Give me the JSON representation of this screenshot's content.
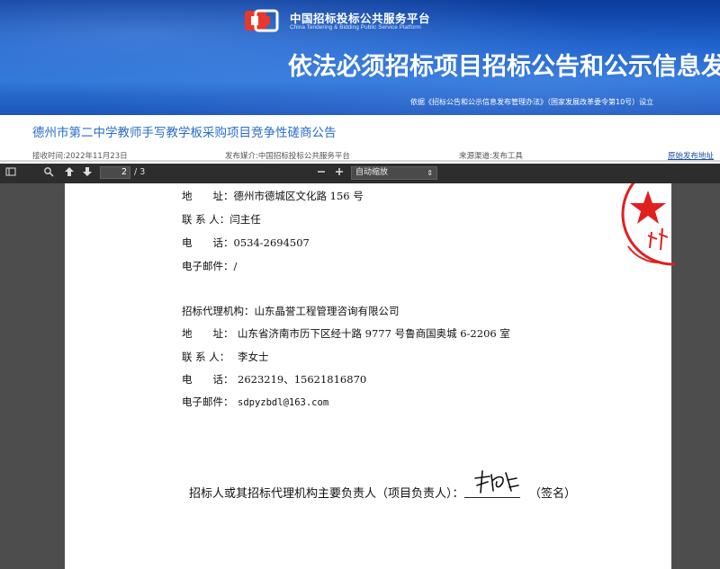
{
  "banner": {
    "logo_cn": "中国招标投标公共服务平台",
    "logo_en": "China Tendering & Bidding Public Service Platform",
    "title": "依法必须招标项目招标公告和公示信息发布",
    "basis": "依据《招标公告和公示信息发布管理办法》（国家发展改革委令第10号）设立"
  },
  "notice": {
    "title": "德州市第二中学教师手写教学板采购项目竞争性磋商公告",
    "received_time": "接收时间:2022年11月23日",
    "publisher": "发布媒介:中国招标投标公共服务平台",
    "source": "来源渠道:发布工具",
    "original_link": "原始发布地址"
  },
  "toolbar": {
    "current_page": "2",
    "total_pages": "/ 3",
    "zoom_label": "自动缩放",
    "icons": [
      "sidebar-toggle-icon",
      "search-icon",
      "arrow-up-icon",
      "arrow-down-icon",
      "zoom-out-icon",
      "zoom-in-icon"
    ]
  },
  "document": {
    "rows": [
      {
        "label": "地　　址：",
        "value": "德州市德城区文化路 156 号"
      },
      {
        "label": "联 系 人：",
        "value": "闫主任"
      },
      {
        "label": "电　　话：",
        "value": "0534-2694507"
      },
      {
        "label": "电子邮件：",
        "value": "/"
      },
      {
        "label": "招标代理机构：",
        "value": "山东晶誉工程管理咨询有限公司"
      },
      {
        "label": "地　　址：",
        "value": "山东省济南市历下区经十路 9777 号鲁商国奥城 6-2206 室"
      },
      {
        "label": "联 系 人：",
        "value": "李女士"
      },
      {
        "label": "电　　话：",
        "value": "2623219、15621816870"
      },
      {
        "label": "电子邮件：",
        "value": "sdpyzbdl@163.com"
      }
    ],
    "sign_prefix": "招标人或其招标代理机构主要负责人（项目负责人）：",
    "sign_suffix": "（签名）"
  },
  "colors": {
    "banner": "#1a5ec9",
    "title_link": "#2a6cc9",
    "stamp": "#e02020",
    "toolbar": "#2d2d2d"
  }
}
